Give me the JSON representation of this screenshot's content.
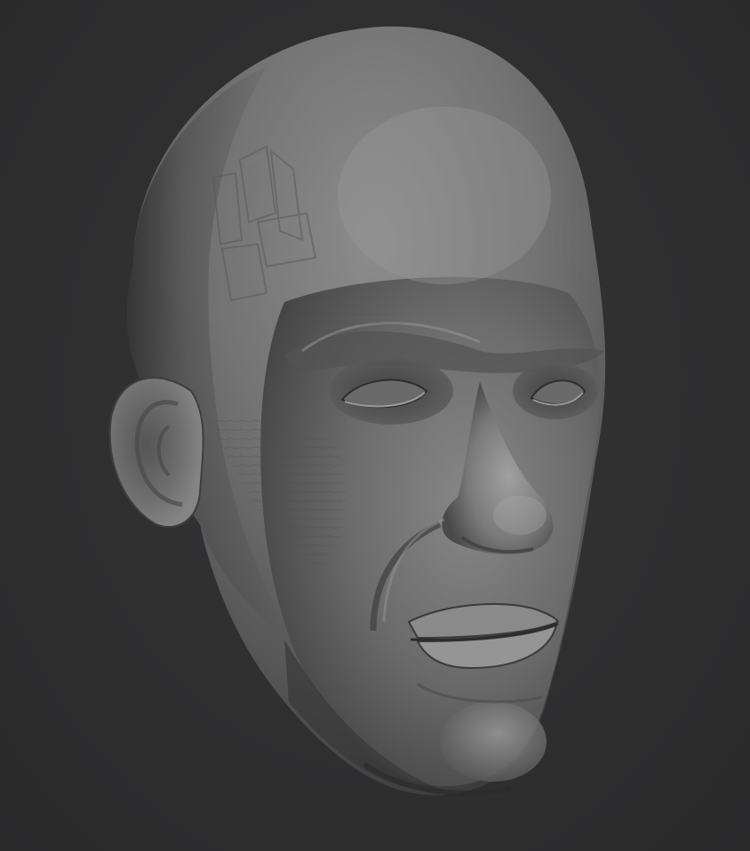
{
  "scene": {
    "background_color": "#2f2f30",
    "subject": "sculpted-head",
    "material_base_color": "#6e6e6e",
    "material_highlight_color": "#a8a8a8",
    "material_shadow_color": "#2a2a2a"
  }
}
